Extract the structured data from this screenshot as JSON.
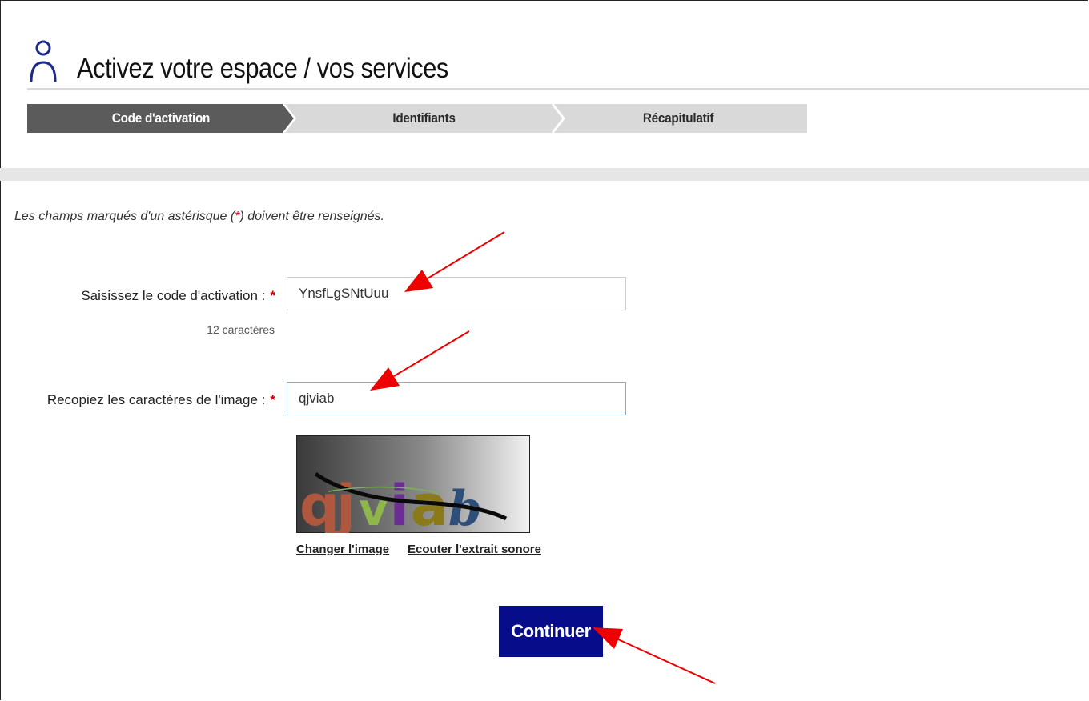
{
  "header": {
    "title": "Activez votre espace / vos services"
  },
  "stepper": {
    "steps": [
      {
        "label": "Code d'activation",
        "active": true
      },
      {
        "label": "Identifiants",
        "active": false
      },
      {
        "label": "Récapitulatif",
        "active": false
      }
    ]
  },
  "form": {
    "note_before": "Les champs marqués d'un astérisque (",
    "note_star": "*",
    "note_after": ") doivent être renseignés.",
    "activation": {
      "label": "Saisissez le code d'activation :",
      "required_mark": "*",
      "value": "YnsfLgSNtUuu",
      "hint": "12 caractères"
    },
    "captcha": {
      "label": "Recopiez les caractères de l'image :",
      "required_mark": "*",
      "value": "qjviab",
      "image_text": "qjviab"
    },
    "change_image_label": "Changer l'image",
    "audio_label": "Ecouter l'extrait sonore",
    "submit_label": "Continuer"
  },
  "colors": {
    "accent": "#060c8a",
    "step_active": "#5b5b5b",
    "step_inactive": "#d9d9d9",
    "required": "#cc0000",
    "annotation_arrow": "#ee0000"
  },
  "icons": {
    "header": "user-icon",
    "annotations": "red-arrow-icon"
  }
}
